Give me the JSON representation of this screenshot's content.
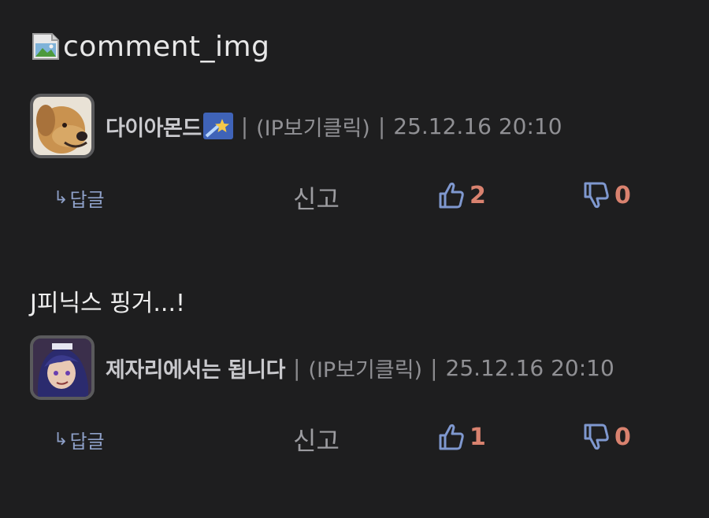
{
  "image_alt": "comment_img",
  "comments": [
    {
      "text": "",
      "nickname": "다이아몬드",
      "badge_icon": "shooting-star-icon",
      "separator": "|",
      "ip_label": "(IP보기클릭)",
      "date": "25.12.16 20:10",
      "reply_label": "답글",
      "report_label": "신고",
      "likes": "2",
      "dislikes": "0"
    },
    {
      "text": "J피닉스 핑거...!",
      "nickname": "제자리에서는 됩니다",
      "separator": "|",
      "ip_label": "(IP보기클릭)",
      "date": "25.12.16 20:10",
      "reply_label": "답글",
      "report_label": "신고",
      "likes": "1",
      "dislikes": "0"
    }
  ],
  "colors": {
    "background": "#1e1e1f",
    "reply_blue": "#8ea0c8",
    "count_orange": "#d9826f",
    "meta_gray": "#909094"
  }
}
